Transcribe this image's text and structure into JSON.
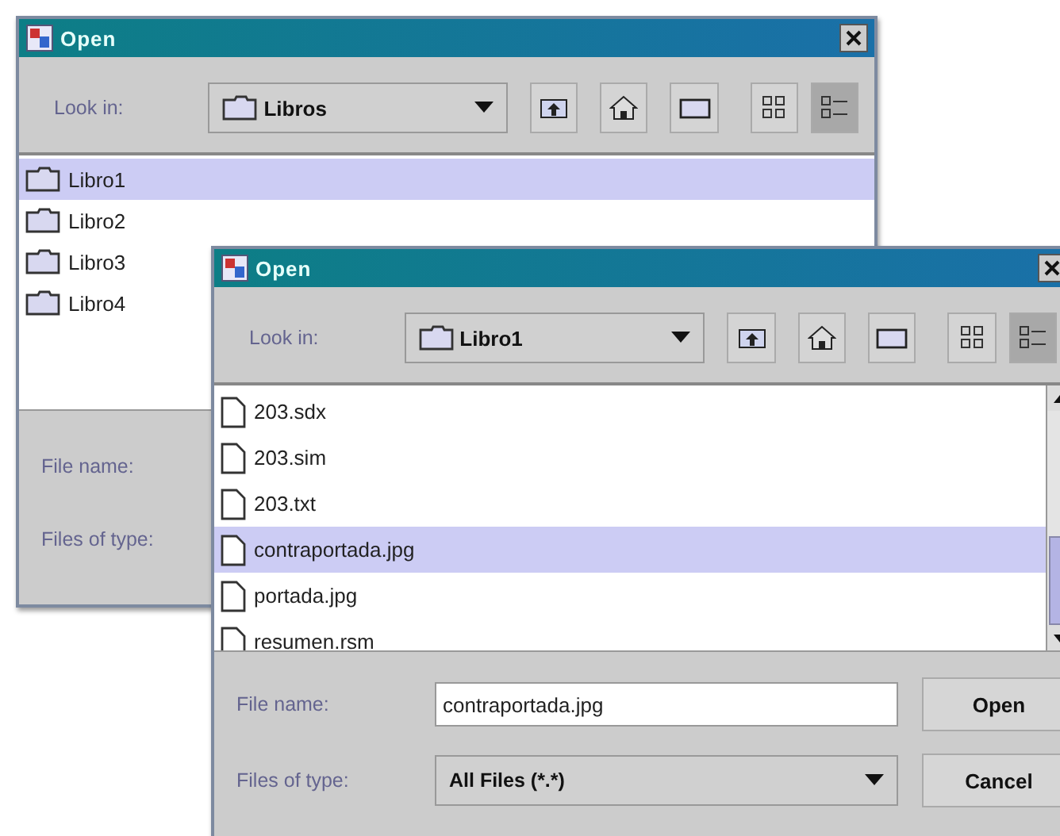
{
  "windows": [
    {
      "title": "Open",
      "look_in_label": "Look in:",
      "look_in_value": "Libros",
      "toolbar_buttons": [
        {
          "kind": "up",
          "selected": false
        },
        {
          "kind": "home",
          "selected": false
        },
        {
          "kind": "new-folder",
          "selected": false
        },
        {
          "kind": "list",
          "selected": false
        },
        {
          "kind": "details",
          "selected": true
        }
      ],
      "items": [
        {
          "kind": "folder",
          "name": "Libro1",
          "selected": true
        },
        {
          "kind": "folder",
          "name": "Libro2",
          "selected": false
        },
        {
          "kind": "folder",
          "name": "Libro3",
          "selected": false
        },
        {
          "kind": "folder",
          "name": "Libro4",
          "selected": false
        }
      ],
      "file_name_label": "File name:",
      "file_type_label": "Files of type:"
    },
    {
      "title": "Open",
      "look_in_label": "Look in:",
      "look_in_value": "Libro1",
      "toolbar_buttons": [
        {
          "kind": "up",
          "selected": false
        },
        {
          "kind": "home",
          "selected": false
        },
        {
          "kind": "new-folder",
          "selected": false
        },
        {
          "kind": "list",
          "selected": false
        },
        {
          "kind": "details",
          "selected": true
        }
      ],
      "items": [
        {
          "kind": "file",
          "name": "203.sdx",
          "selected": false
        },
        {
          "kind": "file",
          "name": "203.sim",
          "selected": false
        },
        {
          "kind": "file",
          "name": "203.txt",
          "selected": false
        },
        {
          "kind": "file",
          "name": "contraportada.jpg",
          "selected": true
        },
        {
          "kind": "file",
          "name": "portada.jpg",
          "selected": false
        },
        {
          "kind": "file",
          "name": "resumen.rsm",
          "selected": false
        }
      ],
      "file_name_label": "File name:",
      "file_name_value": "contraportada.jpg",
      "file_type_label": "Files of type:",
      "file_type_value": "All Files (*.*)",
      "buttons": [
        "Open",
        "Cancel"
      ]
    }
  ]
}
